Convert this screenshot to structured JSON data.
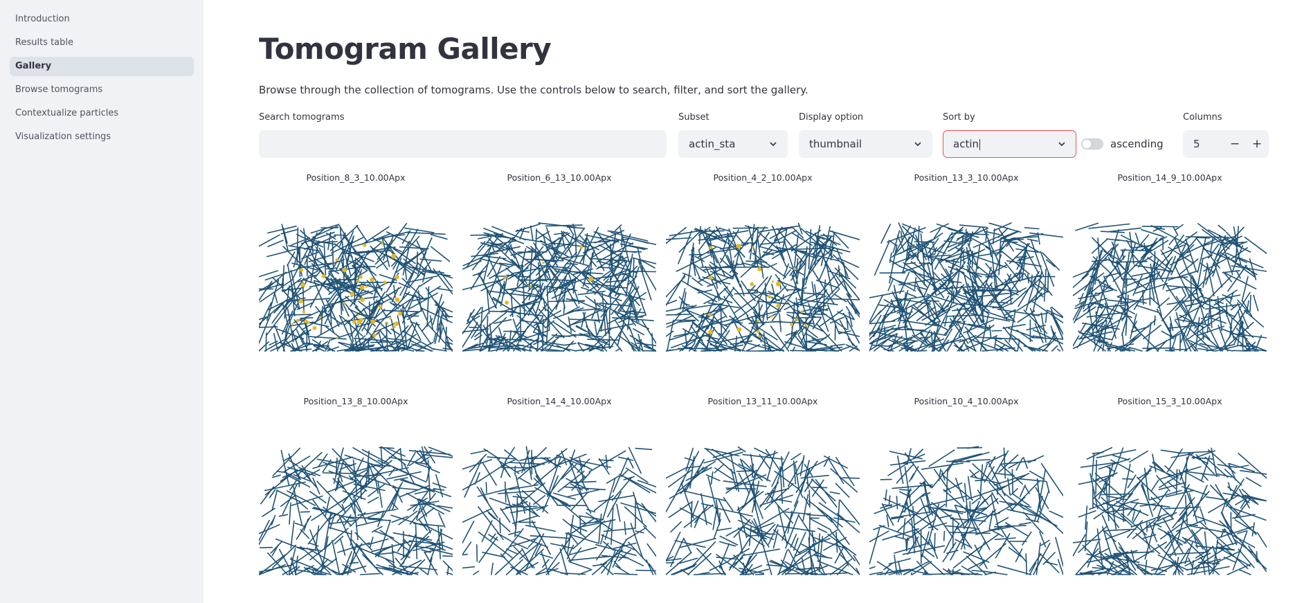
{
  "sidebar": {
    "items": [
      {
        "label": "Introduction",
        "active": false
      },
      {
        "label": "Results table",
        "active": false
      },
      {
        "label": "Gallery",
        "active": true
      },
      {
        "label": "Browse tomograms",
        "active": false
      },
      {
        "label": "Contextualize particles",
        "active": false
      },
      {
        "label": "Visualization settings",
        "active": false
      }
    ]
  },
  "page": {
    "title": "Tomogram Gallery",
    "description": "Browse through the collection of tomograms. Use the controls below to search, filter, and sort the gallery."
  },
  "controls": {
    "search": {
      "label": "Search tomograms",
      "value": ""
    },
    "subset": {
      "label": "Subset",
      "value": "actin_sta"
    },
    "display": {
      "label": "Display option",
      "value": "thumbnail"
    },
    "sort": {
      "label": "Sort by",
      "value": "actin"
    },
    "ascending": {
      "label": "ascending",
      "on": false
    },
    "columns": {
      "label": "Columns",
      "value": "5",
      "minus": "−",
      "plus": "+"
    }
  },
  "colors": {
    "accent": "#ff4b4b",
    "filament": "#1f5275",
    "particle": "#e8b81c",
    "sidebar_bg": "#f0f2f6"
  },
  "tomograms": [
    {
      "name": "Position_8_3_10.00Apx",
      "density": 1.0,
      "particles": 40
    },
    {
      "name": "Position_6_13_10.00Apx",
      "density": 1.0,
      "particles": 6
    },
    {
      "name": "Position_4_2_10.00Apx",
      "density": 0.9,
      "particles": 22
    },
    {
      "name": "Position_13_3_10.00Apx",
      "density": 1.0,
      "particles": 0
    },
    {
      "name": "Position_14_9_10.00Apx",
      "density": 0.85,
      "particles": 0
    },
    {
      "name": "Position_13_8_10.00Apx",
      "density": 0.7,
      "particles": 0
    },
    {
      "name": "Position_14_4_10.00Apx",
      "density": 0.55,
      "particles": 0
    },
    {
      "name": "Position_13_11_10.00Apx",
      "density": 0.6,
      "particles": 0
    },
    {
      "name": "Position_10_4_10.00Apx",
      "density": 0.6,
      "particles": 0
    },
    {
      "name": "Position_15_3_10.00Apx",
      "density": 0.65,
      "particles": 0
    }
  ]
}
